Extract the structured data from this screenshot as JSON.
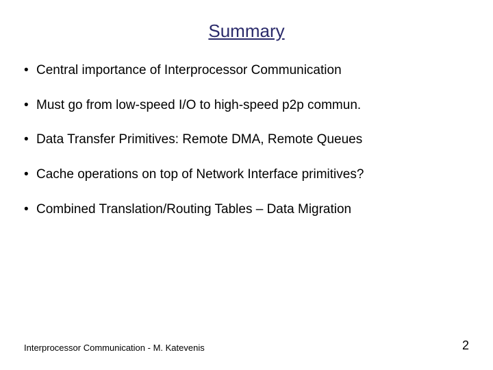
{
  "title": "Summary",
  "bullets": [
    "Central importance of Interprocessor Communication",
    "Must go from low-speed I/O to high-speed p2p commun.",
    "Data Transfer Primitives: Remote DMA, Remote Queues",
    "Cache operations on top of Network Interface primitives?",
    "Combined Translation/Routing Tables – Data Migration"
  ],
  "footer_text": "Interprocessor Communication - M. Katevenis",
  "page_number": "2"
}
